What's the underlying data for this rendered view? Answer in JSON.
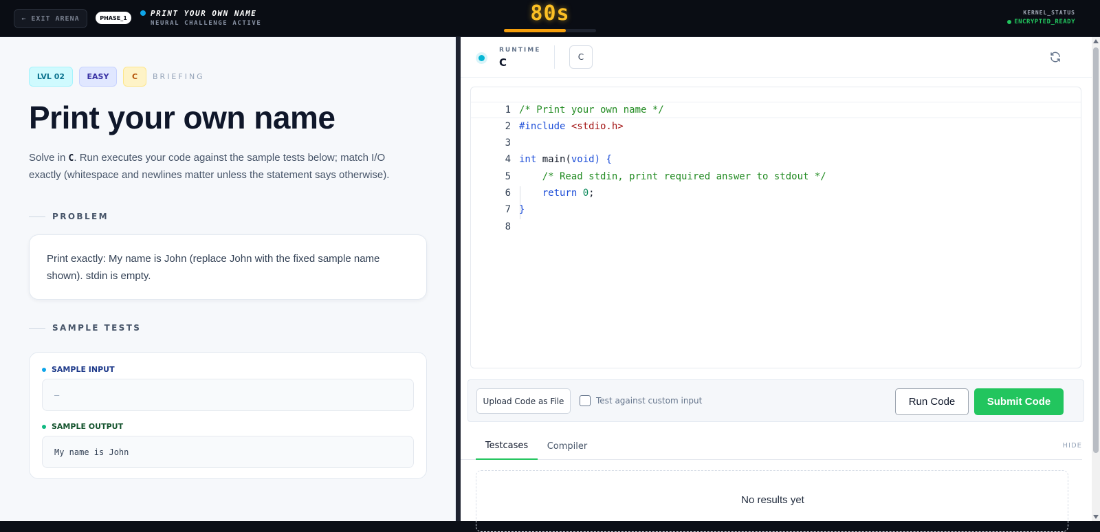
{
  "topbar": {
    "exit_label": "← EXIT ARENA",
    "phase": "PHASE_1",
    "challenge_title": "PRINT YOUR OWN NAME",
    "challenge_subtitle": "NEURAL CHALLENGE ACTIVE",
    "timer": "80s",
    "timer_progress": 0.67,
    "kernel_label": "KERNEL_STATUS",
    "kernel_value": "ENCRYPTED_READY"
  },
  "problem": {
    "tags": {
      "level": "LVL 02",
      "difficulty": "EASY",
      "language": "C",
      "briefing": "BRIEFING"
    },
    "title": "Print your own name",
    "desc_pre": "Solve in ",
    "desc_lang": "C",
    "desc_post": ". Run executes your code against the sample tests below; match I/O exactly (whitespace and newlines matter unless the statement says otherwise).",
    "problem_heading": "PROBLEM",
    "statement": "Print exactly: My name is John (replace John with the fixed sample name shown). stdin is empty.",
    "samples_heading": "SAMPLE TESTS",
    "sample_input_label": "SAMPLE INPUT",
    "sample_input": "—",
    "sample_output_label": "SAMPLE OUTPUT",
    "sample_output": "My name is John"
  },
  "editor": {
    "runtime_label": "RUNTIME",
    "runtime_value": "C",
    "language_select": "C",
    "refresh_icon": "refresh-icon",
    "line_numbers": [
      "1",
      "2",
      "3",
      "4",
      "5",
      "6",
      "7",
      "8"
    ],
    "code": {
      "l1": "/* Print your own name */",
      "l2_pre": "#include ",
      "l2_inc": "<stdio.h>",
      "l4_kw": "int",
      "l4_fn": " main(",
      "l4_void": "void",
      "l4_end": ") {",
      "l5": "    /* Read stdin, print required answer to stdout */",
      "l6_kw": "    return",
      "l6_sp": " ",
      "l6_num": "0",
      "l6_end": ";",
      "l7": "}"
    }
  },
  "actions": {
    "upload_label": "Upload Code as File",
    "custom_input_label": "Test against custom input",
    "run_label": "Run Code",
    "submit_label": "Submit Code"
  },
  "results": {
    "tab_testcases": "Testcases",
    "tab_compiler": "Compiler",
    "hide_label": "HIDE",
    "empty_message": "No results yet"
  },
  "colors": {
    "timer": "#fbbf24",
    "submit": "#22c55e",
    "kernel_ok": "#22c55e",
    "runtime_dot": "#06b6d4"
  }
}
